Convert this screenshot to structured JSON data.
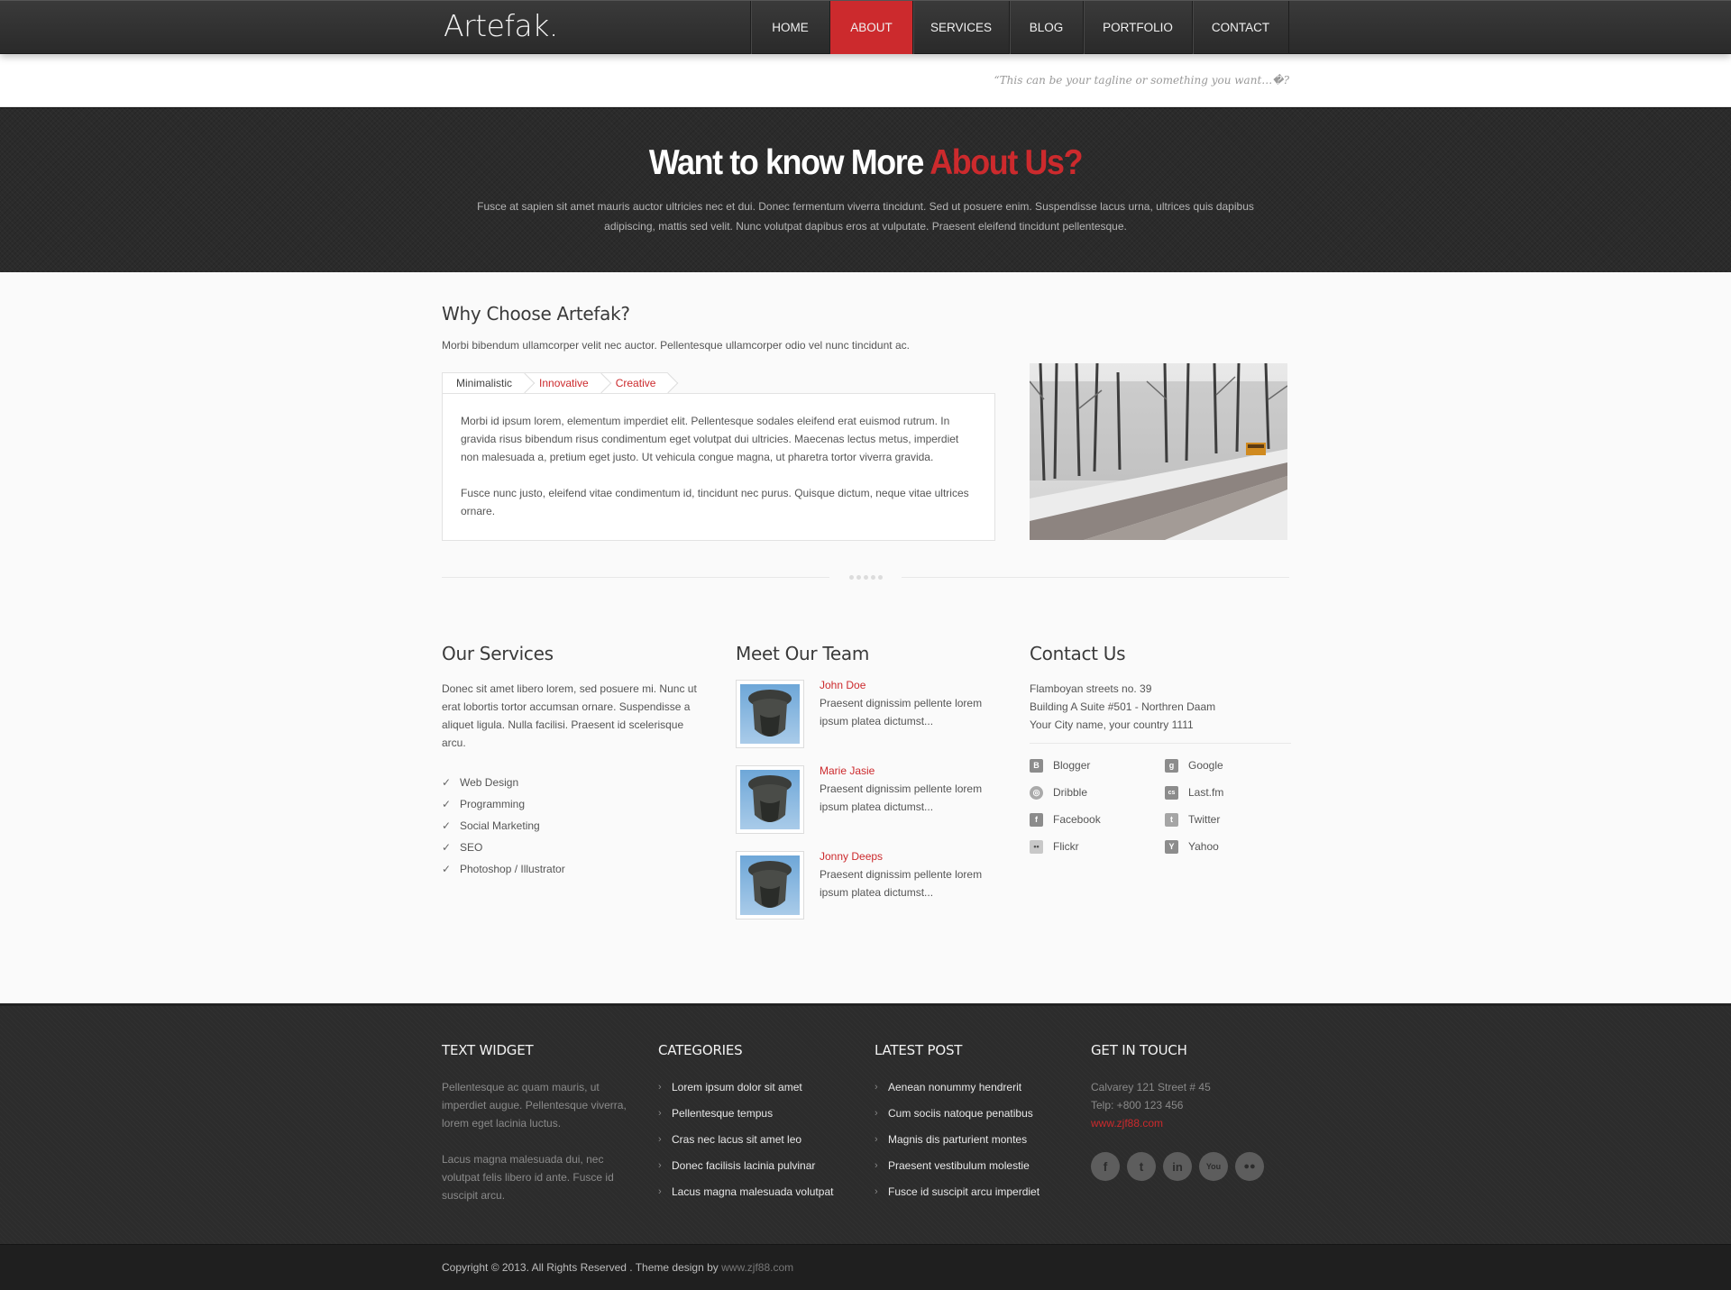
{
  "header": {
    "logo": "Artefak.",
    "nav": [
      "HOME",
      "ABOUT",
      "SERVICES",
      "BLOG",
      "PORTFOLIO",
      "CONTACT"
    ],
    "active_nav": "ABOUT",
    "tagline": "“This can be your tagline or something you want…�?"
  },
  "hero": {
    "title_main": "Want to know More ",
    "title_accent": "About Us?",
    "text": "Fusce at sapien sit amet mauris auctor ultricies nec et dui. Donec fermentum viverra tincidunt. Sed ut posuere enim. Suspendisse lacus urna, ultrices quis dapibus adipiscing, mattis sed velit. Nunc volutpat dapibus eros at vulputate. Praesent eleifend tincidunt pellentesque."
  },
  "why": {
    "title": "Why Choose Artefak?",
    "intro": "Morbi bibendum ullamcorper velit nec auctor. Pellentesque ullamcorper odio vel nunc tincidunt ac.",
    "tabs": [
      "Minimalistic",
      "Innovative",
      "Creative"
    ],
    "paragraphs": [
      "Morbi id ipsum lorem, elementum imperdiet elit. Pellentesque sodales eleifend erat euismod rutrum. In gravida risus bibendum risus condimentum eget volutpat dui ultricies. Maecenas lectus metus, imperdiet non malesuada a, pretium eget justo. Ut vehicula congue magna, ut pharetra tortor viverra gravida.",
      "Fusce nunc justo, eleifend vitae condimentum id, tincidunt nec purus. Quisque dictum, neque vitae ultrices ornare."
    ]
  },
  "services": {
    "title": "Our Services",
    "text": "Donec sit amet libero lorem, sed posuere mi. Nunc ut erat lobortis tortor accumsan ornare. Suspendisse a aliquet ligula. Nulla facilisi. Praesent id scelerisque arcu.",
    "items": [
      "Web Design",
      "Programming",
      "Social Marketing",
      "SEO",
      "Photoshop / Illustrator"
    ]
  },
  "team": {
    "title": "Meet Our Team",
    "members": [
      {
        "name": "John Doe",
        "text": "Praesent dignissim pellente lorem ipsum platea dictumst..."
      },
      {
        "name": "Marie Jasie",
        "text": "Praesent dignissim pellente lorem ipsum platea dictumst..."
      },
      {
        "name": "Jonny Deeps",
        "text": "Praesent dignissim pellente lorem ipsum platea dictumst..."
      }
    ]
  },
  "contact": {
    "title": "Contact Us",
    "address": [
      "Flamboyan streets no. 39",
      "Building A Suite #501 - Northren Daam",
      "Your City name, your country 1111"
    ],
    "social": [
      {
        "label": "Blogger",
        "icon": "blogger-icon"
      },
      {
        "label": "Google",
        "icon": "google-icon"
      },
      {
        "label": "Dribble",
        "icon": "dribbble-icon"
      },
      {
        "label": "Last.fm",
        "icon": "lastfm-icon"
      },
      {
        "label": "Facebook",
        "icon": "facebook-icon"
      },
      {
        "label": "Twitter",
        "icon": "twitter-icon"
      },
      {
        "label": "Flickr",
        "icon": "flickr-icon"
      },
      {
        "label": "Yahoo",
        "icon": "yahoo-icon"
      }
    ]
  },
  "footer": {
    "text_widget": {
      "title": "TEXT WIDGET",
      "paragraphs": [
        "Pellentesque ac quam mauris, ut imperdiet augue. Pellentesque viverra, lorem eget lacinia luctus.",
        "Lacus magna malesuada dui, nec volutpat felis libero id ante. Fusce id suscipit arcu."
      ]
    },
    "categories": {
      "title": "CATEGORIES",
      "items": [
        "Lorem ipsum dolor sit amet",
        "Pellentesque tempus",
        "Cras nec lacus sit amet leo",
        "Donec facilisis lacinia pulvinar",
        "Lacus magna malesuada volutpat"
      ]
    },
    "latest_post": {
      "title": "LATEST POST",
      "items": [
        "Aenean nonummy hendrerit",
        "Cum sociis natoque penatibus",
        "Magnis dis parturient montes",
        "Praesent vestibulum molestie",
        "Fusce id suscipit arcu imperdiet"
      ]
    },
    "get_in_touch": {
      "title": "GET IN TOUCH",
      "lines": [
        "Calvarey 121 Street # 45",
        "Telp: +800 123 456"
      ],
      "link": "www.zjf88.com",
      "icons": [
        "facebook-icon",
        "twitter-icon",
        "linkedin-icon",
        "youtube-icon",
        "flickr-icon"
      ]
    },
    "copyright": "Copyright © 2013. All Rights Reserved . Theme design by ",
    "copyright_site": "www.zjf88.com"
  },
  "colors": {
    "accent": "#cc2a2d",
    "dark": "#2b2b2b",
    "background": "#fafafa"
  }
}
